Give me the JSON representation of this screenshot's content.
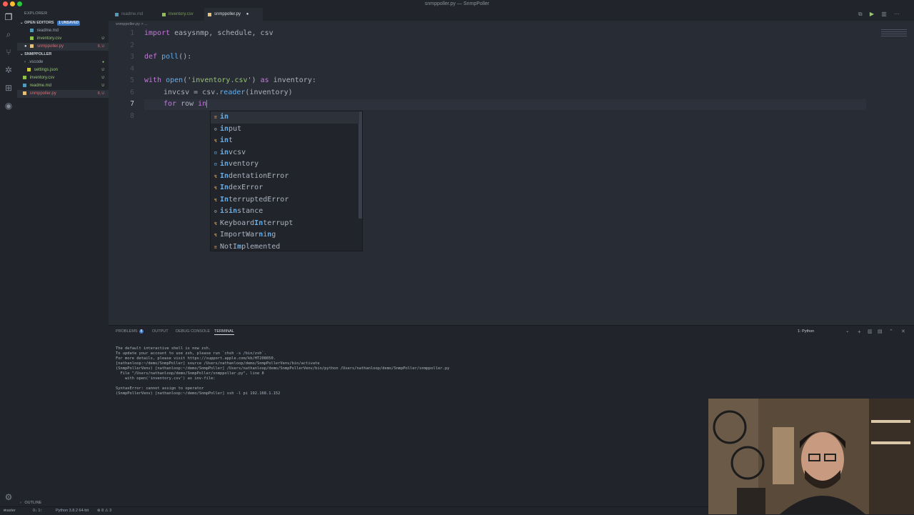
{
  "window": {
    "title": "snmppoller.py — SnmpPoller"
  },
  "sidebar": {
    "header": "EXPLORER",
    "open_editors": {
      "label": "OPEN EDITORS",
      "badge": "1 UNSAVED",
      "items": [
        {
          "name": "readme.md",
          "status": "",
          "color": "#519aba"
        },
        {
          "name": "inventory.csv",
          "status": "U",
          "color": "#8dc149"
        },
        {
          "name": "snmppoller.py",
          "status": "8, U",
          "color": "#e5c07b"
        }
      ]
    },
    "project": {
      "label": "SNMPPOLLER",
      "items": [
        {
          "name": ".vscode",
          "status": "",
          "color": "#6d8086"
        },
        {
          "name": "settings.json",
          "status": "U",
          "color": "#cbcb41"
        },
        {
          "name": "inventory.csv",
          "status": "U",
          "color": "#8dc149"
        },
        {
          "name": "readme.md",
          "status": "U",
          "color": "#519aba"
        },
        {
          "name": "snmppoller.py",
          "status": "8, U",
          "color": "#e5c07b"
        }
      ]
    },
    "outline_label": "OUTLINE"
  },
  "tabs": [
    {
      "label": "readme.md",
      "color": "#519aba"
    },
    {
      "label": "inventory.csv",
      "color": "#8dc149"
    },
    {
      "label": "snmppoller.py",
      "color": "#e5c07b"
    }
  ],
  "breadcrumb": "snmppoller.py > ...",
  "editor": {
    "line_numbers": [
      "1",
      "2",
      "3",
      "4",
      "5",
      "6",
      "7",
      "8"
    ],
    "current_line": "7",
    "lines": {
      "l1": {
        "kw": "import",
        "rest": " easysnmp, schedule, csv"
      },
      "l3": {
        "kw": "def",
        "fn": " poll",
        "rest": "():"
      },
      "l5": {
        "kw": "with",
        "fn": " open",
        "p1": "(",
        "str": "'inventory.csv'",
        "p2": ") ",
        "kw2": "as",
        "rest": " inventory:"
      },
      "l6": {
        "var": "invcsv",
        "rest": " = csv.",
        "fn": "reader",
        "rest2": "(inventory)"
      },
      "l7": {
        "kw": "for",
        "rest": " row ",
        "kw2": "in"
      }
    }
  },
  "suggestions": [
    {
      "pre": "",
      "match": "in",
      "post": "",
      "icon": "kw"
    },
    {
      "pre": "",
      "match": "in",
      "post": "put",
      "icon": "fn"
    },
    {
      "pre": "",
      "match": "in",
      "post": "t",
      "icon": "cls"
    },
    {
      "pre": "",
      "match": "in",
      "post": "vcsv",
      "icon": "var"
    },
    {
      "pre": "",
      "match": "in",
      "post": "ventory",
      "icon": "var"
    },
    {
      "pre": "",
      "match": "In",
      "post": "dentationError",
      "icon": "cls"
    },
    {
      "pre": "",
      "match": "In",
      "post": "dexError",
      "icon": "cls"
    },
    {
      "pre": "",
      "match": "In",
      "post": "terruptedError",
      "icon": "cls"
    },
    {
      "pre": "",
      "match": "i",
      "post": "s",
      "post_match": "in",
      "post2": "stance",
      "icon": "fn"
    },
    {
      "pre": "Keyboard",
      "match": "In",
      "post": "terrupt",
      "icon": "cls"
    },
    {
      "pre": "ImportWar",
      "match": "n",
      "post": "i",
      "post_match": "n",
      "post2": "g",
      "icon": "cls"
    },
    {
      "pre": "NotI",
      "match": "m",
      "post": "plemented",
      "icon": "kw"
    }
  ],
  "panel": {
    "tabs": {
      "problems": "PROBLEMS",
      "problems_count": "8",
      "output": "OUTPUT",
      "debug": "DEBUG CONSOLE",
      "terminal": "TERMINAL"
    },
    "terminal_select": "1: Python",
    "terminal_lines": [
      "The default interactive shell is now zsh.",
      "To update your account to use zsh, please run `chsh -s /bin/zsh`.",
      "For more details, please visit https://support.apple.com/kb/HT208050.",
      "[nathanloop:~/demo/SnmpPoller] source /Users/nathanloop/demo/SnmpPollerVenv/bin/activate",
      "(SnmpPollerVenv) [nathanloop:~/demo/SnmpPoller] /Users/nathanloop/demo/SnmpPollerVenv/bin/python /Users/nathanloop/demo/SnmpPoller/snmppoller.py",
      "  File \"/Users/nathanloop/demo/SnmpPoller/snmppoller.py\", line 8",
      "    with open('inventory.csv') as inv-file:",
      "",
      "SyntaxError: cannot assign to operator",
      "(SnmpPollerVenv) [nathanloop:~/demo/SnmpPoller] ssh -l pi 192.168.1.152"
    ]
  },
  "statusbar": {
    "branch": "master",
    "sync": "0↓ 1↑",
    "python": "Python 3.8.2 64-bit",
    "problems": "⊗ 8  ⚠ 3"
  }
}
